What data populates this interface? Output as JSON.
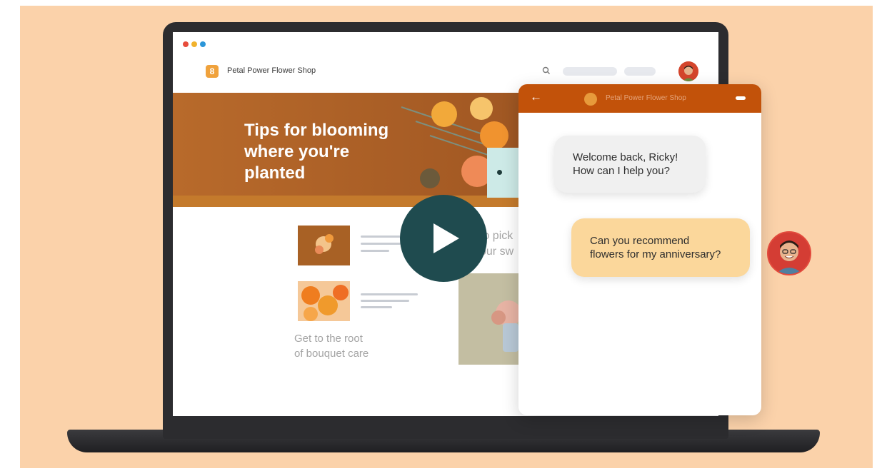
{
  "browser": {
    "dots": [
      "#e74c3c",
      "#f1b22d",
      "#2c96d8"
    ]
  },
  "site": {
    "name": "Petal Power Flower Shop",
    "logo_letter": "8"
  },
  "hero": {
    "title": "Tips for blooming\nwhere you're\nplanted"
  },
  "articles": {
    "caption": "Get to the root\nof bouquet care",
    "faded_caption": "to pick\nour sw"
  },
  "chat": {
    "back_symbol": "←",
    "header_title": "Petal Power Flower Shop",
    "messages": [
      {
        "from": "bot",
        "text": "Welcome back, Ricky!\nHow can I help you?"
      },
      {
        "from": "user",
        "text": "Can you recommend\nflowers for my anniversary?"
      }
    ]
  },
  "colors": {
    "background": "#fbd2aa",
    "accent": "#c2520a",
    "play_button": "#1f4b4f",
    "user_bubble": "#fbd79b",
    "bot_bubble": "#f0f0f0"
  },
  "icons": [
    "search-icon",
    "play-icon",
    "back-arrow-icon",
    "minimize-icon",
    "bot-icon",
    "user-avatar"
  ]
}
